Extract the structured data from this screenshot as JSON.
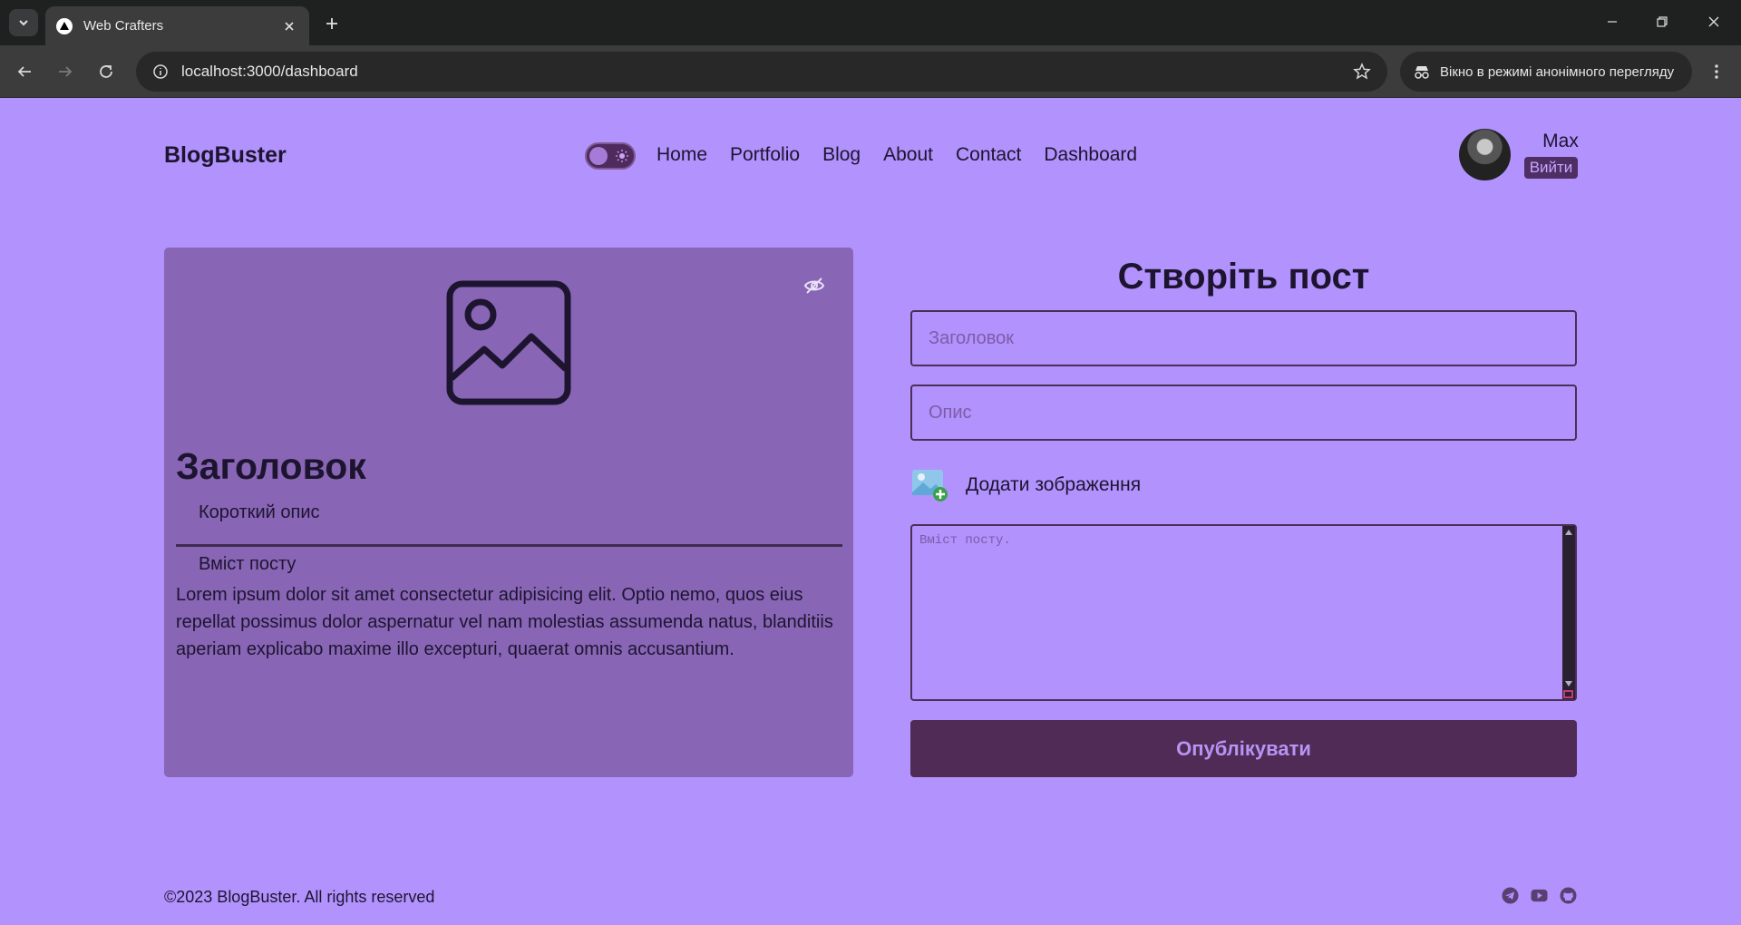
{
  "browser": {
    "tab_title": "Web Crafters",
    "url": "localhost:3000/dashboard",
    "incognito_label": "Вікно в режимі анонімного перегляду"
  },
  "header": {
    "logo": "BlogBuster",
    "nav": [
      "Home",
      "Portfolio",
      "Blog",
      "About",
      "Contact",
      "Dashboard"
    ],
    "user_name": "Max",
    "logout_label": "Вийти"
  },
  "preview": {
    "title": "Заголовок",
    "description": "Короткий опис",
    "content_label": "Вміст посту",
    "body": "Lorem ipsum dolor sit amet consectetur adipisicing elit. Optio nemo, quos eius repellat possimus dolor aspernatur vel nam molestias assumenda natus, blanditiis aperiam explicabo maxime illo excepturi, quaerat omnis accusantium."
  },
  "form": {
    "title": "Створіть пост",
    "title_placeholder": "Заголовок",
    "desc_placeholder": "Опис",
    "add_image_label": "Додати зображення",
    "content_placeholder": "Вміст посту.",
    "publish_label": "Опублікувати"
  },
  "footer": {
    "copyright": "©2023 BlogBuster. All rights reserved",
    "social_icons": [
      "telegram-icon",
      "youtube-icon",
      "github-icon"
    ]
  },
  "colors": {
    "page_bg": "#b292fd",
    "card_bg": "#8865b5",
    "accent_dark": "#4f2b56",
    "button_text": "#b794f4"
  }
}
